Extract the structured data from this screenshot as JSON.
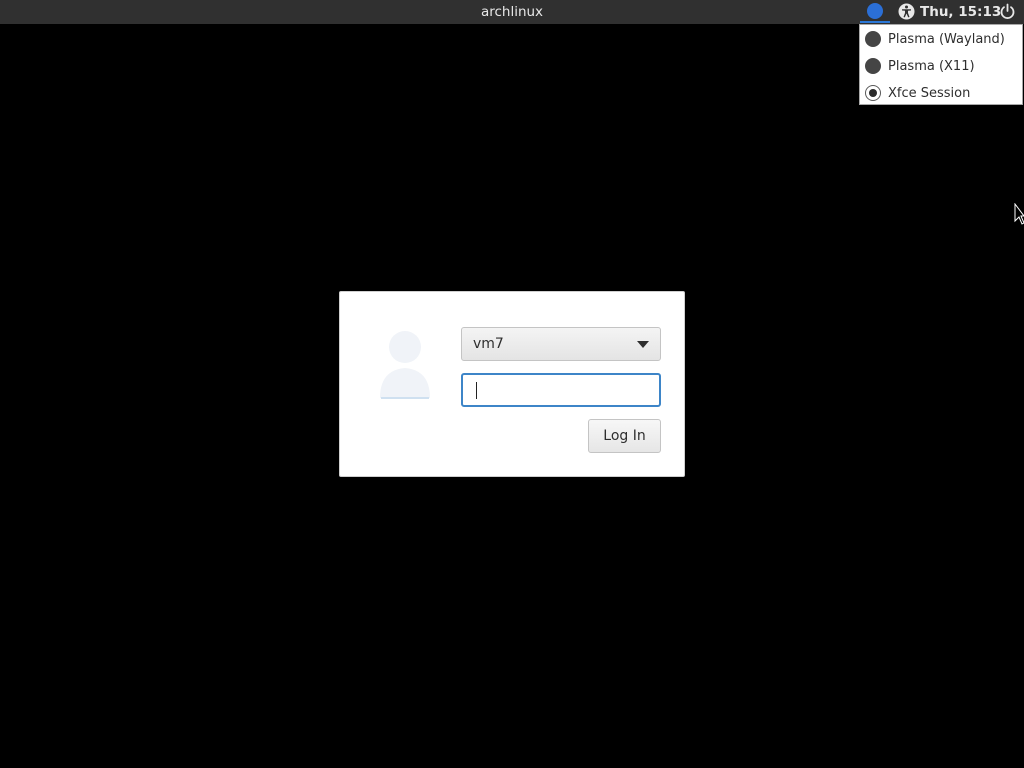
{
  "topbar": {
    "hostname": "archlinux",
    "clock": "Thu, 15:13",
    "icons": {
      "session": "xfce-session-icon",
      "accessibility": "accessibility-icon",
      "power": "power-icon"
    }
  },
  "session_menu": {
    "items": [
      {
        "label": "Plasma (Wayland)",
        "checked": false
      },
      {
        "label": "Plasma (X11)",
        "checked": false
      },
      {
        "label": "Xfce Session",
        "checked": true
      }
    ]
  },
  "login": {
    "user": "vm7",
    "password": "",
    "login_label": "Log In",
    "avatar_icon": "user-avatar-icon"
  },
  "colors": {
    "topbar_bg": "#303030",
    "accent": "#3d85c8",
    "background": "#000000"
  }
}
